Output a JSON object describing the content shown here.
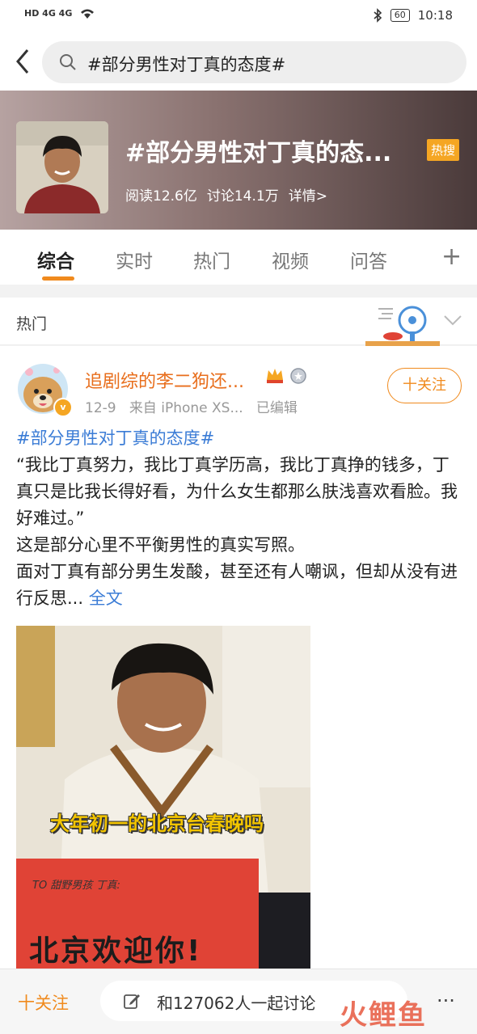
{
  "status_bar": {
    "signal_left": "HD 4G 4G",
    "battery": "60",
    "time": "10:18"
  },
  "search": {
    "query": "#部分男性对丁真的态度#"
  },
  "topic": {
    "title": "#部分男性对丁真的态...",
    "badge": "热搜",
    "reads": "阅读12.6亿",
    "discussions": "讨论14.1万",
    "details": "详情>"
  },
  "tabs": [
    {
      "label": "综合",
      "active": true
    },
    {
      "label": "实时",
      "active": false
    },
    {
      "label": "热门",
      "active": false
    },
    {
      "label": "视频",
      "active": false
    },
    {
      "label": "问答",
      "active": false
    }
  ],
  "section": {
    "label": "热门"
  },
  "post": {
    "user_name": "追剧综的李二狗还...",
    "date": "12-9",
    "source": "来自 iPhone XS...",
    "edited": "已编辑",
    "follow_label": "十关注",
    "hashtag": "#部分男性对丁真的态度#",
    "body_1": "“我比丁真努力，我比丁真学历高，我比丁真挣的钱多，丁真只是比我长得好看，为什么女生都那么肤浅喜欢看脸。我好难过。”",
    "body_2": "这是部分心里不平衡男性的真实写照。",
    "body_3": "面对丁真有部分男生发酸，甚至还有人嘲讽，但却从没有进行反思...",
    "more_link": "全文",
    "image_caption": "大年初一的北京台春晚吗",
    "sign_small": "TO 甜野男孩 丁真:",
    "sign_big": "北京欢迎你!"
  },
  "bottom_bar": {
    "follow_label": "十关注",
    "discuss_placeholder": "和127062人一起讨论",
    "more": "..."
  },
  "watermark": "火鲤鱼",
  "colors": {
    "accent": "#f08a1d",
    "link": "#3b7cd6",
    "hot_badge": "#f5a623"
  }
}
